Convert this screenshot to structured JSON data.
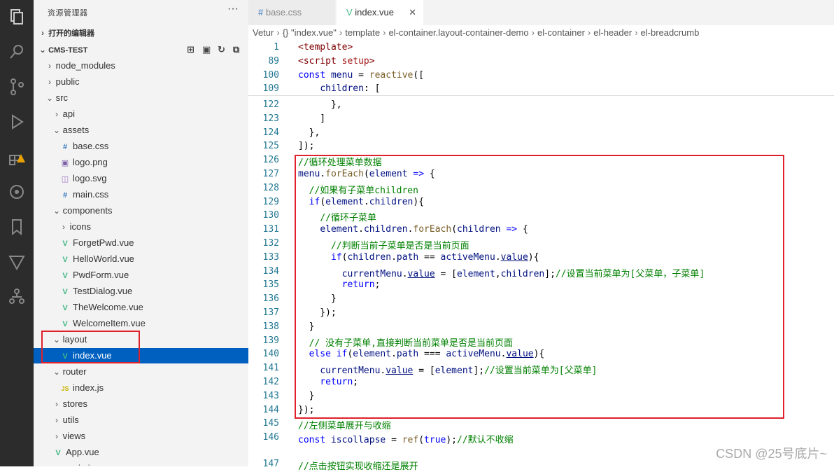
{
  "activity_bar": [
    "explorer-icon",
    "search-icon",
    "source-control-icon",
    "run-debug-icon",
    "extensions-icon",
    "remote-icon",
    "bookmark-icon",
    "vite-icon",
    "tree-icon"
  ],
  "sidebar": {
    "title": "资源管理器",
    "more": "···",
    "open_editors": "打开的编辑器",
    "project": "CMS-TEST",
    "tree": [
      {
        "label": "node_modules",
        "type": "folder",
        "indent": 1,
        "expanded": false
      },
      {
        "label": "public",
        "type": "folder",
        "indent": 1,
        "expanded": false
      },
      {
        "label": "src",
        "type": "folder",
        "indent": 1,
        "expanded": true
      },
      {
        "label": "api",
        "type": "folder",
        "indent": 2,
        "expanded": false
      },
      {
        "label": "assets",
        "type": "folder",
        "indent": 2,
        "expanded": true
      },
      {
        "label": "base.css",
        "type": "css",
        "indent": 3
      },
      {
        "label": "logo.png",
        "type": "img",
        "indent": 3
      },
      {
        "label": "logo.svg",
        "type": "svg",
        "indent": 3
      },
      {
        "label": "main.css",
        "type": "css",
        "indent": 3
      },
      {
        "label": "components",
        "type": "folder",
        "indent": 2,
        "expanded": true
      },
      {
        "label": "icons",
        "type": "folder",
        "indent": 3,
        "expanded": false
      },
      {
        "label": "ForgetPwd.vue",
        "type": "vue",
        "indent": 3
      },
      {
        "label": "HelloWorld.vue",
        "type": "vue",
        "indent": 3
      },
      {
        "label": "PwdForm.vue",
        "type": "vue",
        "indent": 3
      },
      {
        "label": "TestDialog.vue",
        "type": "vue",
        "indent": 3
      },
      {
        "label": "TheWelcome.vue",
        "type": "vue",
        "indent": 3
      },
      {
        "label": "WelcomeItem.vue",
        "type": "vue",
        "indent": 3
      },
      {
        "label": "layout",
        "type": "folder",
        "indent": 2,
        "expanded": true
      },
      {
        "label": "index.vue",
        "type": "vue",
        "indent": 3,
        "selected": true
      },
      {
        "label": "router",
        "type": "folder",
        "indent": 2,
        "expanded": true
      },
      {
        "label": "index.js",
        "type": "js",
        "indent": 3
      },
      {
        "label": "stores",
        "type": "folder",
        "indent": 2,
        "expanded": false
      },
      {
        "label": "utils",
        "type": "folder",
        "indent": 2,
        "expanded": false
      },
      {
        "label": "views",
        "type": "folder",
        "indent": 2,
        "expanded": false
      },
      {
        "label": "App.vue",
        "type": "vue",
        "indent": 2
      },
      {
        "label": "main.js",
        "type": "js",
        "indent": 2
      }
    ]
  },
  "tabs": [
    {
      "label": "base.css",
      "icon": "#",
      "active": false
    },
    {
      "label": "index.vue",
      "icon": "V",
      "active": true,
      "close": "✕"
    }
  ],
  "breadcrumb": [
    "Vetur",
    "{} \"index.vue\"",
    "template",
    "el-container.layout-container-demo",
    "el-container",
    "el-header",
    "el-breadcrumb"
  ],
  "code_lines": [
    {
      "n": "1",
      "html": "<span class='tag'>&lt;template&gt;</span>"
    },
    {
      "n": "89",
      "html": "<span class='tag'>&lt;script</span> <span class='str'>setup</span><span class='tag'>&gt;</span>"
    },
    {
      "n": "100",
      "html": "<span class='kw'>const</span> <span class='var'>menu</span> = <span class='fn'>reactive</span>(["
    },
    {
      "n": "109",
      "html": "    <span class='var'>children</span>: ["
    },
    {
      "n": "122",
      "html": "      },"
    },
    {
      "n": "123",
      "html": "    ]"
    },
    {
      "n": "124",
      "html": "  },"
    },
    {
      "n": "125",
      "html": "]);"
    },
    {
      "n": "126",
      "html": "<span class='cm'>//循环处理菜单数据</span>"
    },
    {
      "n": "127",
      "html": "<span class='var'>menu</span>.<span class='fn'>forEach</span>(<span class='var'>element</span> <span class='kw'>=&gt;</span> {"
    },
    {
      "n": "128",
      "html": "  <span class='cm'>//如果有子菜单children</span>"
    },
    {
      "n": "129",
      "html": "  <span class='kw'>if</span>(<span class='var'>element</span>.<span class='var'>children</span>){"
    },
    {
      "n": "130",
      "html": "    <span class='cm'>//循环子菜单</span>"
    },
    {
      "n": "131",
      "html": "    <span class='var'>element</span>.<span class='var'>children</span>.<span class='fn'>forEach</span>(<span class='var'>children</span> <span class='kw'>=&gt;</span> {"
    },
    {
      "n": "132",
      "html": "      <span class='cm'>//判断当前子菜单是否是当前页面</span>"
    },
    {
      "n": "133",
      "html": "      <span class='kw'>if</span>(<span class='var'>children</span>.<span class='var'>path</span> == <span class='var'>activeMenu</span>.<span class='var ul'>value</span>){"
    },
    {
      "n": "134",
      "html": "        <span class='var'>currentMenu</span>.<span class='var ul'>value</span> = [<span class='var'>element</span>,<span class='var'>children</span>];<span class='cm'>//设置当前菜单为[父菜单，子菜单]</span>"
    },
    {
      "n": "135",
      "html": "        <span class='kw'>return</span>;"
    },
    {
      "n": "136",
      "html": "      }"
    },
    {
      "n": "137",
      "html": "    });"
    },
    {
      "n": "138",
      "html": "  }"
    },
    {
      "n": "139",
      "html": "  <span class='cm'>// 没有子菜单,直接判断当前菜单是否是当前页面</span>"
    },
    {
      "n": "140",
      "html": "  <span class='kw'>else</span> <span class='kw'>if</span>(<span class='var'>element</span>.<span class='var'>path</span> === <span class='var'>activeMenu</span>.<span class='var ul'>value</span>){"
    },
    {
      "n": "141",
      "html": "    <span class='var'>currentMenu</span>.<span class='var ul'>value</span> = [<span class='var'>element</span>];<span class='cm'>//设置当前菜单为[父菜单]</span>"
    },
    {
      "n": "142",
      "html": "    <span class='kw'>return</span>;"
    },
    {
      "n": "143",
      "html": "  }"
    },
    {
      "n": "144",
      "html": "});"
    },
    {
      "n": "145",
      "html": "<span class='cm'>//左侧菜单展开与收缩</span>"
    },
    {
      "n": "146",
      "html": "<span class='kw'>const</span> <span class='var'>iscollapse</span> = <span class='fn'>ref</span>(<span class='kw'>true</span>);<span class='cm'>//默认不收缩</span>"
    },
    {
      "n": "147",
      "html": "<span class='cm'>//点击按钮实现收缩还是展开</span>"
    }
  ],
  "watermark": "CSDN @25号底片~",
  "colors": {
    "activity_bg": "#2c2c2c",
    "sidebar_bg": "#f3f3f3",
    "selected_bg": "#0060c0",
    "highlight_box": "#e0202a"
  }
}
